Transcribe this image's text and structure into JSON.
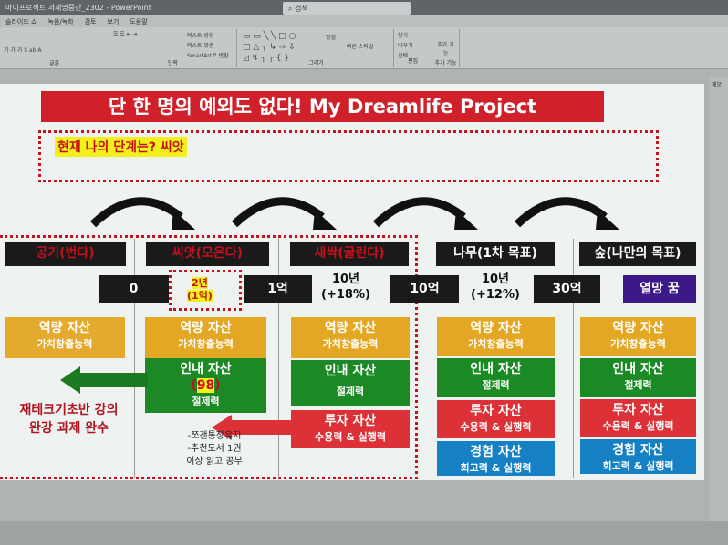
{
  "window": {
    "title": "마이프로젝트 과제명중간_2302 - PowerPoint",
    "search": "검색"
  },
  "menu": [
    "슬라이드 쇼",
    "녹음/녹화",
    "검토",
    "보기",
    "도움말"
  ],
  "ribbon": {
    "groups": [
      "글꼴",
      "단락",
      "그리기",
      "편집",
      "추가 기능"
    ],
    "paragraph_items": [
      "텍스트 방향",
      "텍스트 맞춤",
      "SmartArt로 변환"
    ],
    "drawing_items": [
      "정렬",
      "빠른 스타일"
    ],
    "edit_items": [
      "찾기",
      "바꾸기",
      "선택"
    ],
    "addin": "추가 기능"
  },
  "side_panel": {
    "label": "메모"
  },
  "slide": {
    "title": "단 한 명의 예외도 없다! My Dreamlife Project",
    "current_stage": "현재 나의 단계는? 씨앗",
    "stages": [
      {
        "label": "공기(번다)",
        "color": "#c8101c"
      },
      {
        "label": "씨앗(모은다)",
        "color": "#c8101c"
      },
      {
        "label": "새싹(굴린다)",
        "color": "#c8101c"
      },
      {
        "label": "나무(1차 목표)",
        "color": "#ffffff"
      },
      {
        "label": "숲(나만의 목표)",
        "color": "#ffffff"
      }
    ],
    "milestones": [
      "0",
      "1억",
      "10억",
      "30억",
      "열망 꿈"
    ],
    "periods": [
      {
        "years": "2년",
        "amount": "(1억)"
      },
      {
        "years": "10년",
        "rate": "(+18%)"
      },
      {
        "years": "10년",
        "rate": "(+12%)"
      }
    ],
    "assets": {
      "capability": {
        "title": "역량 자산",
        "sub": "가치창출능력"
      },
      "patience": {
        "title": "인내 자산",
        "sub": "절제력",
        "score": "98"
      },
      "investment": {
        "title": "투자 자산",
        "sub": "수용력 & 실행력"
      },
      "experience": {
        "title": "경험 자산",
        "sub": "회고력 & 실행력"
      }
    },
    "task": "재테크기초반 강의 완강 과제 완수",
    "notes": [
      "-쪼갠통장유지",
      "-추천도서 1권",
      "이상 읽고 공부"
    ]
  }
}
